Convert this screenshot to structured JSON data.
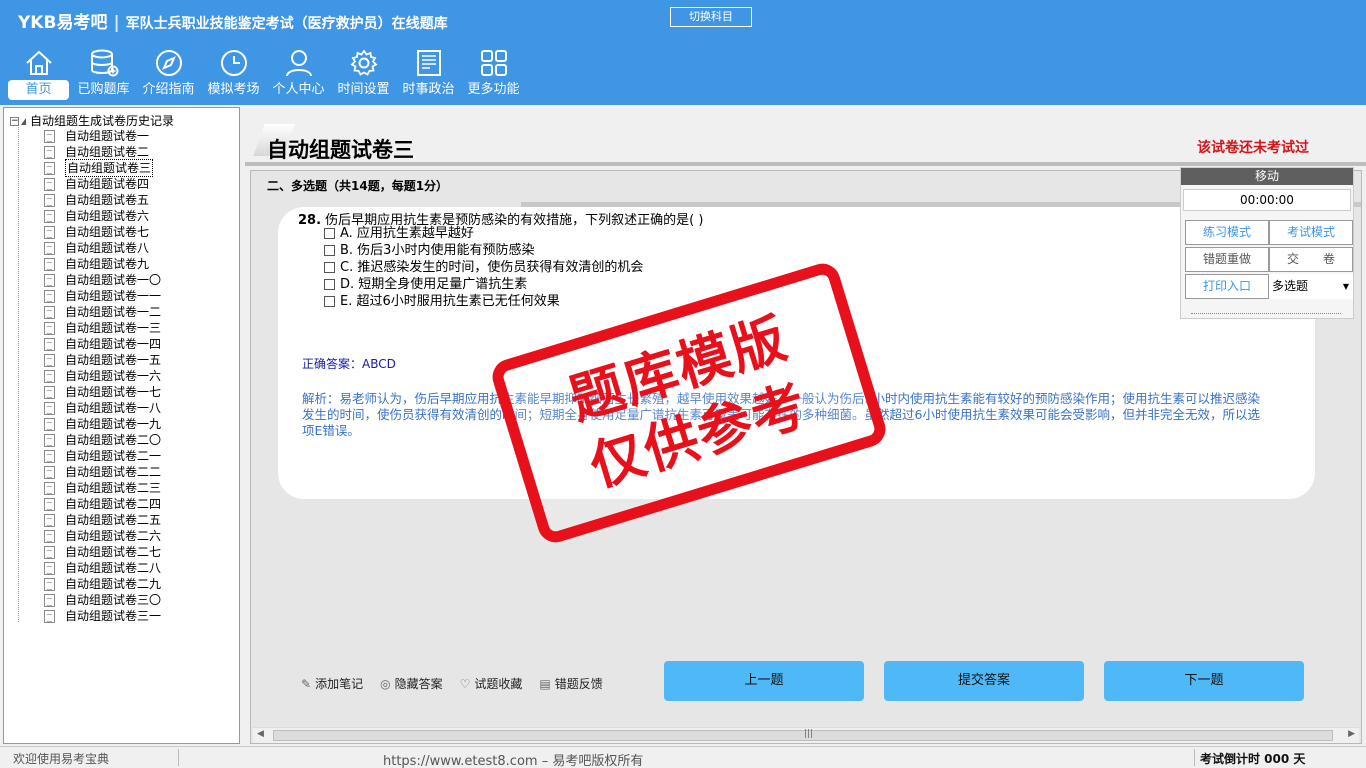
{
  "header": {
    "brand": "YKB易考吧",
    "app_title": "军队士兵职业技能鉴定考试（医疗救护员）在线题库",
    "switch_subject": "切换科目",
    "nav": [
      {
        "label": "首页",
        "icon": "home-icon"
      },
      {
        "label": "已购题库",
        "icon": "database-icon"
      },
      {
        "label": "介绍指南",
        "icon": "compass-icon"
      },
      {
        "label": "模拟考场",
        "icon": "clock-icon"
      },
      {
        "label": "个人中心",
        "icon": "user-icon"
      },
      {
        "label": "时间设置",
        "icon": "gear-icon"
      },
      {
        "label": "时事政治",
        "icon": "news-icon"
      },
      {
        "label": "更多功能",
        "icon": "grid-icon"
      }
    ]
  },
  "tree": {
    "root": "自动组题生成试卷历史记录",
    "items": [
      "自动组题试卷一",
      "自动组题试卷二",
      "自动组题试卷三",
      "自动组题试卷四",
      "自动组题试卷五",
      "自动组题试卷六",
      "自动组题试卷七",
      "自动组题试卷八",
      "自动组题试卷九",
      "自动组题试卷一〇",
      "自动组题试卷一一",
      "自动组题试卷一二",
      "自动组题试卷一三",
      "自动组题试卷一四",
      "自动组题试卷一五",
      "自动组题试卷一六",
      "自动组题试卷一七",
      "自动组题试卷一八",
      "自动组题试卷一九",
      "自动组题试卷二〇",
      "自动组题试卷二一",
      "自动组题试卷二二",
      "自动组题试卷二三",
      "自动组题试卷二四",
      "自动组题试卷二五",
      "自动组题试卷二六",
      "自动组题试卷二七",
      "自动组题试卷二八",
      "自动组题试卷二九",
      "自动组题试卷三〇",
      "自动组题试卷三一"
    ],
    "selected_index": 2
  },
  "paper": {
    "title": "自动组题试卷三",
    "status": "该试卷还未考试过",
    "section": "二、多选题（共14题，每题1分）"
  },
  "question": {
    "number": "28.",
    "stem": "伤后早期应用抗生素是预防感染的有效措施，下列叙述正确的是( )",
    "options": [
      "A. 应用抗生素越早越好",
      "B. 伤后3小时内使用能有预防感染",
      "C. 推迟感染发生的时间，使伤员获得有效清创的机会",
      "D. 短期全身使用足量广谱抗生素",
      "E. 超过6小时服用抗生素已无任何效果"
    ],
    "answer_label": "正确答案：",
    "answer_value": "ABCD",
    "analysis": "解析：易老师认为，伤后早期应用抗生素能早期抑制细菌生长繁殖，越早使用效果越好，一般认为伤后3小时内使用抗生素能有较好的预防感染作用；使用抗生素可以推迟感染发生的时间，使伤员获得有效清创的时间；短期全身使用足量广谱抗生素可覆盖可能存在的多种细菌。虽然超过6小时使用抗生素效果可能会受影响，但并非完全无效，所以选项E错误。"
  },
  "tools": [
    {
      "label": "添加笔记",
      "icon": "pencil-icon"
    },
    {
      "label": "隐藏答案",
      "icon": "eye-icon"
    },
    {
      "label": "试题收藏",
      "icon": "heart-icon"
    },
    {
      "label": "错题反馈",
      "icon": "feedback-icon"
    }
  ],
  "nav_buttons": {
    "prev": "上一题",
    "submit": "提交答案",
    "next": "下一题"
  },
  "panel": {
    "title": "移动",
    "timer": "00:00:00",
    "practice_mode": "练习模式",
    "exam_mode": "考试模式",
    "redo_wrong": "错题重做",
    "hand_in": "交　　卷",
    "print": "打印入口",
    "type_select": "多选题"
  },
  "watermark": {
    "line1": "题库模版",
    "line2": "仅供参考"
  },
  "status": {
    "welcome": "欢迎使用易考宝典",
    "url": "https://www.etest8.com – 易考吧版权所有",
    "countdown": "考试倒计时 000 天"
  }
}
